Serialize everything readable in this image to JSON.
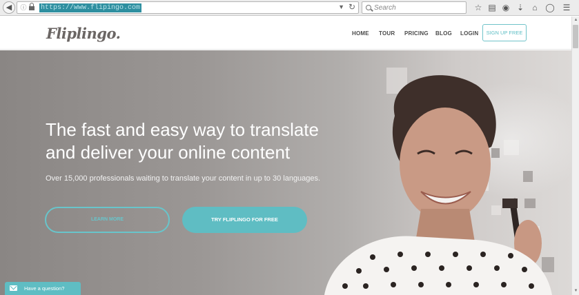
{
  "browser": {
    "url": "https://www.flipingo.com",
    "search_placeholder": "Search",
    "icons": [
      "info-icon",
      "lock-icon",
      "dropdown-icon",
      "reload-icon",
      "search-icon",
      "star-icon",
      "reading-list-icon",
      "pocket-icon",
      "download-icon",
      "home-icon",
      "shield-icon",
      "menu-icon"
    ]
  },
  "site": {
    "logo": "Fliplingo.",
    "nav": {
      "home": "HOME",
      "tour": "TOUR",
      "pricing": "PRICING",
      "blog": "BLOG",
      "login": "LOGIN",
      "signup": "SIGN UP FREE"
    }
  },
  "hero": {
    "title_line1": "The fast and easy way to translate",
    "title_line2": "and deliver your online content",
    "subtitle": "Over 15,000 professionals waiting to translate your content in up to 30 languages.",
    "learn_more": "LEARN MORE",
    "try_free": "TRY FLIPLINGO FOR FREE"
  },
  "chat": {
    "label": "Have a question?"
  },
  "colors": {
    "accent": "#5fbdc3",
    "text_dark": "#4a4a4a",
    "logo": "#6b6664",
    "hero_overlay": "#9b9795"
  }
}
